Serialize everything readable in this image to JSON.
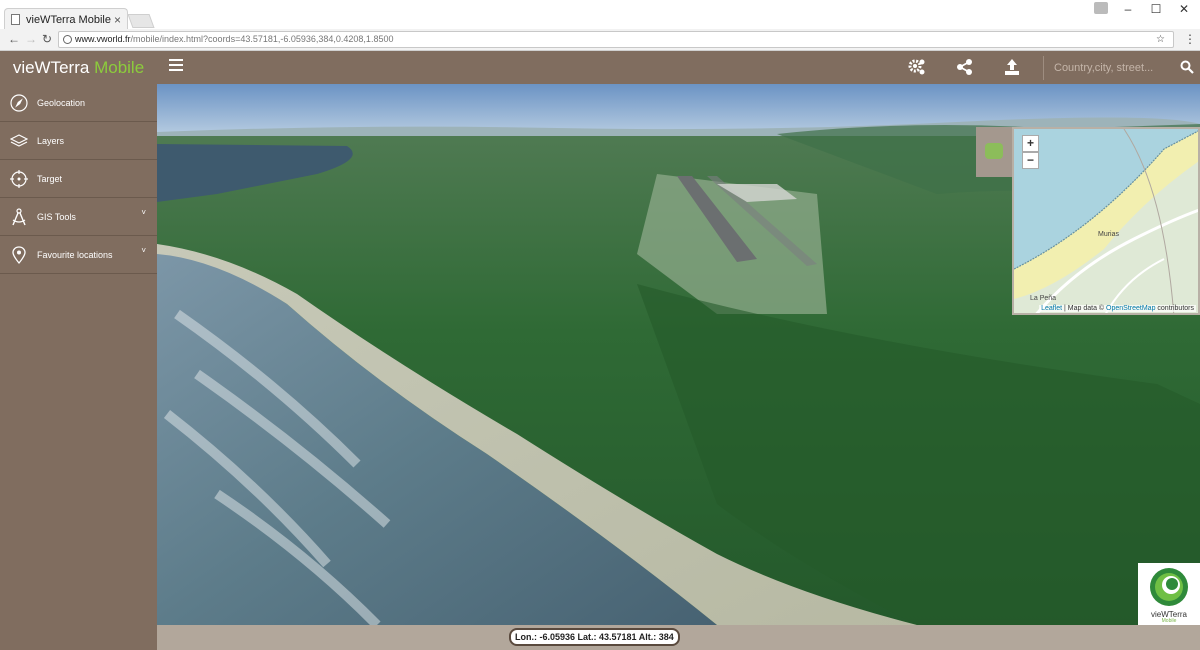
{
  "browser": {
    "tab_title": "vieWTerra Mobile",
    "tab_close": "×",
    "url_host": "www.vworld.fr",
    "url_path": "/mobile/index.html?coords=43.57181,-6.05936,384,0.4208,1.8500",
    "window_controls": [
      "–",
      "☐",
      "✕"
    ]
  },
  "header": {
    "logo_main": "vieWTerra",
    "logo_sub": "Mobile",
    "search_placeholder": "Country,city, street...",
    "icons": [
      "hamburger-menu-icon",
      "settings-gears-icon",
      "share-icon",
      "upload-icon",
      "search-icon"
    ]
  },
  "sidebar": {
    "items": [
      {
        "label": "Geolocation",
        "icon": "compass-icon",
        "has_submenu": false
      },
      {
        "label": "Layers",
        "icon": "layers-icon",
        "has_submenu": false
      },
      {
        "label": "Target",
        "icon": "target-icon",
        "has_submenu": false
      },
      {
        "label": "GIS Tools",
        "icon": "compass-drawing-icon",
        "has_submenu": true
      },
      {
        "label": "Favourite locations",
        "icon": "map-pin-icon",
        "has_submenu": true
      }
    ],
    "chevron": "˅"
  },
  "minimap": {
    "zoom_in": "+",
    "zoom_out": "−",
    "labels": [
      "Murias",
      "La Peña"
    ],
    "attribution_leaflet": "Leaflet",
    "attribution_mid": " | Map data © ",
    "attribution_osm": "OpenStreetMap",
    "attribution_end": " contributors"
  },
  "status": {
    "coords_text": "Lon.: -6.05936  Lat.: 43.57181  Alt.: 384"
  },
  "brand": {
    "name": "vieWTerra",
    "sub": "Mobile"
  },
  "colors": {
    "brown": "#806d5f",
    "accent_green": "#8ccc3c",
    "status_bar": "#b2a79b"
  }
}
